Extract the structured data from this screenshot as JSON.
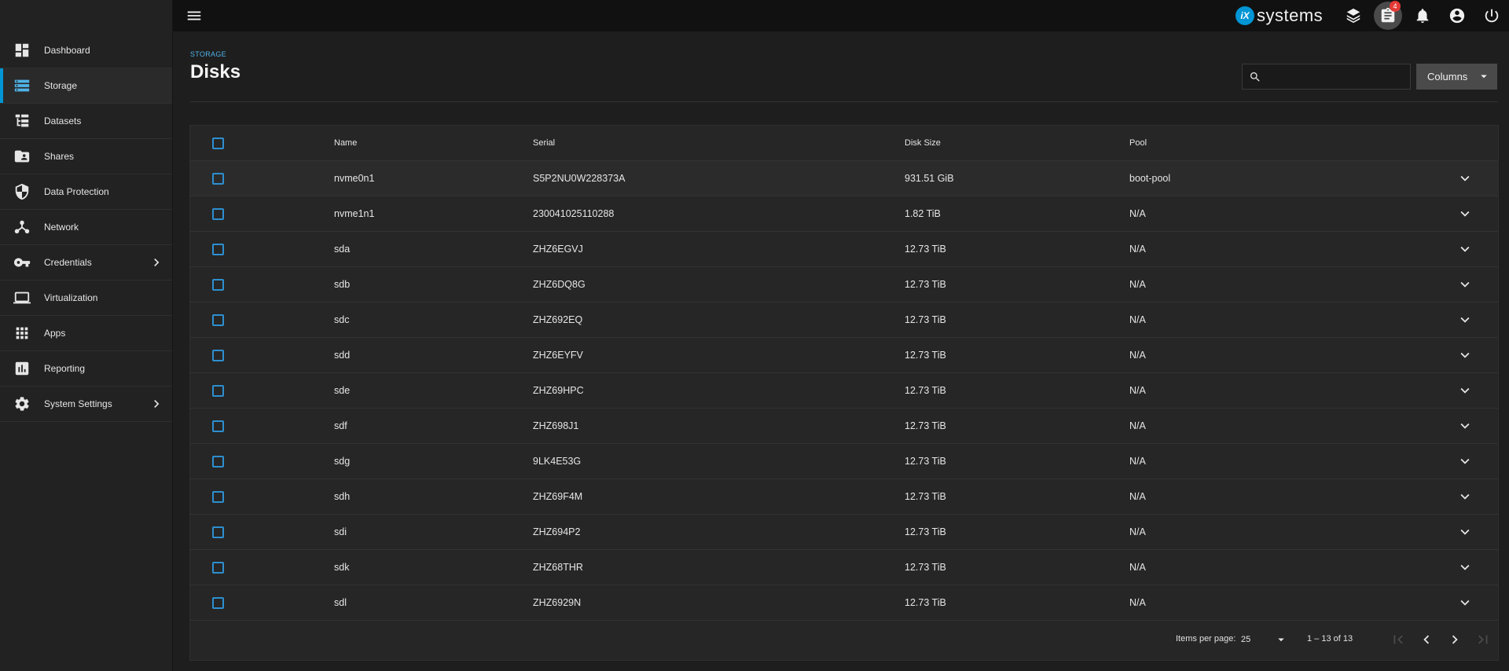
{
  "sidebar": {
    "items": [
      {
        "label": "Dashboard",
        "icon": "dashboard-icon",
        "active": false,
        "chevron": false
      },
      {
        "label": "Storage",
        "icon": "storage-icon",
        "active": true,
        "chevron": false
      },
      {
        "label": "Datasets",
        "icon": "datasets-icon",
        "active": false,
        "chevron": false
      },
      {
        "label": "Shares",
        "icon": "shares-icon",
        "active": false,
        "chevron": false
      },
      {
        "label": "Data Protection",
        "icon": "shield-icon",
        "active": false,
        "chevron": false
      },
      {
        "label": "Network",
        "icon": "network-icon",
        "active": false,
        "chevron": false
      },
      {
        "label": "Credentials",
        "icon": "key-icon",
        "active": false,
        "chevron": true
      },
      {
        "label": "Virtualization",
        "icon": "laptop-icon",
        "active": false,
        "chevron": false
      },
      {
        "label": "Apps",
        "icon": "apps-grid-icon",
        "active": false,
        "chevron": false
      },
      {
        "label": "Reporting",
        "icon": "reporting-icon",
        "active": false,
        "chevron": false
      },
      {
        "label": "System Settings",
        "icon": "gear-icon",
        "active": false,
        "chevron": true
      }
    ]
  },
  "topbar": {
    "brand_mark": "iX",
    "brand_text": "systems",
    "task_badge": "4"
  },
  "header": {
    "breadcrumb": "STORAGE",
    "title": "Disks",
    "search_placeholder": "",
    "columns_label": "Columns"
  },
  "table": {
    "headers": {
      "name": "Name",
      "serial": "Serial",
      "disk_size": "Disk Size",
      "pool": "Pool"
    },
    "rows": [
      {
        "name": "nvme0n1",
        "serial": "S5P2NU0W228373A",
        "disk_size": "931.51 GiB",
        "pool": "boot-pool"
      },
      {
        "name": "nvme1n1",
        "serial": "230041025110288",
        "disk_size": "1.82 TiB",
        "pool": "N/A"
      },
      {
        "name": "sda",
        "serial": "ZHZ6EGVJ",
        "disk_size": "12.73 TiB",
        "pool": "N/A"
      },
      {
        "name": "sdb",
        "serial": "ZHZ6DQ8G",
        "disk_size": "12.73 TiB",
        "pool": "N/A"
      },
      {
        "name": "sdc",
        "serial": "ZHZ692EQ",
        "disk_size": "12.73 TiB",
        "pool": "N/A"
      },
      {
        "name": "sdd",
        "serial": "ZHZ6EYFV",
        "disk_size": "12.73 TiB",
        "pool": "N/A"
      },
      {
        "name": "sde",
        "serial": "ZHZ69HPC",
        "disk_size": "12.73 TiB",
        "pool": "N/A"
      },
      {
        "name": "sdf",
        "serial": "ZHZ698J1",
        "disk_size": "12.73 TiB",
        "pool": "N/A"
      },
      {
        "name": "sdg",
        "serial": "9LK4E53G",
        "disk_size": "12.73 TiB",
        "pool": "N/A"
      },
      {
        "name": "sdh",
        "serial": "ZHZ69F4M",
        "disk_size": "12.73 TiB",
        "pool": "N/A"
      },
      {
        "name": "sdi",
        "serial": "ZHZ694P2",
        "disk_size": "12.73 TiB",
        "pool": "N/A"
      },
      {
        "name": "sdk",
        "serial": "ZHZ68THR",
        "disk_size": "12.73 TiB",
        "pool": "N/A"
      },
      {
        "name": "sdl",
        "serial": "ZHZ6929N",
        "disk_size": "12.73 TiB",
        "pool": "N/A"
      }
    ]
  },
  "paginator": {
    "items_per_page_label": "Items per page:",
    "items_per_page": "25",
    "range": "1 – 13 of 13"
  },
  "colors": {
    "accent": "#0095d5",
    "background": "#1e1e1e",
    "sidebar": "#222222",
    "topbar": "#111111",
    "card": "#262626",
    "badge": "#e53935"
  }
}
